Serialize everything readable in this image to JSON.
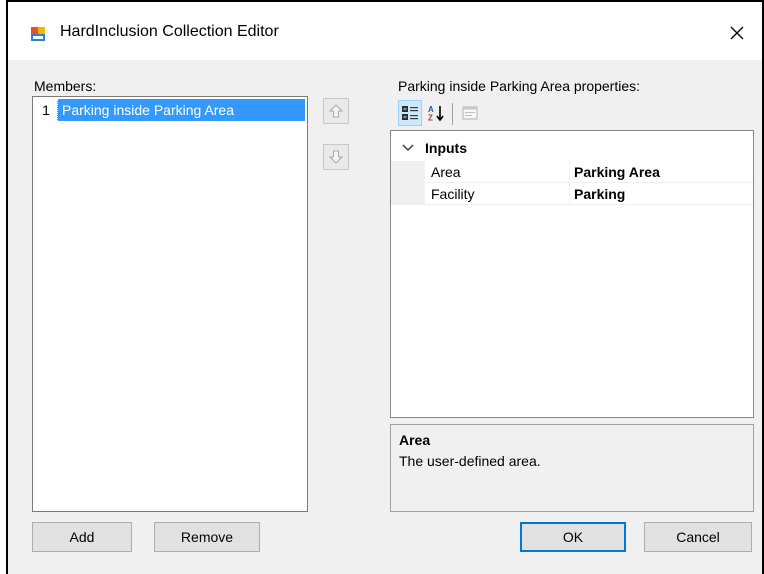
{
  "window": {
    "title": "HardInclusion Collection Editor"
  },
  "members": {
    "label": "Members:",
    "items": [
      {
        "index": "1",
        "label": "Parking inside Parking Area",
        "selected": true
      }
    ]
  },
  "buttons": {
    "add": "Add",
    "remove": "Remove",
    "ok": "OK",
    "cancel": "Cancel"
  },
  "properties": {
    "label": "Parking inside Parking Area properties:",
    "toolbar": [
      "categorized-view",
      "alphabetical-sort",
      "property-pages"
    ],
    "category": "Inputs",
    "rows": [
      {
        "name": "Area",
        "value": "Parking Area"
      },
      {
        "name": "Facility",
        "value": "Parking"
      }
    ]
  },
  "help": {
    "title": "Area",
    "description": "The user-defined area."
  },
  "colors": {
    "selection": "#3399ff",
    "default_button_border": "#0078d7",
    "dialog_background": "#f0f0f0"
  }
}
